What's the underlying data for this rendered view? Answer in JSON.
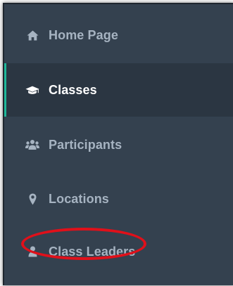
{
  "sidebar": {
    "items": [
      {
        "label": "Home Page",
        "icon": "home-icon",
        "active": false
      },
      {
        "label": "Classes",
        "icon": "graduation-cap-icon",
        "active": true
      },
      {
        "label": "Participants",
        "icon": "users-icon",
        "active": false
      },
      {
        "label": "Locations",
        "icon": "map-marker-icon",
        "active": false
      },
      {
        "label": "Class Leaders",
        "icon": "user-icon",
        "active": false
      }
    ]
  },
  "colors": {
    "sidebar_background": "#34414f",
    "active_background": "#2b3642",
    "active_accent": "#1fb89a",
    "inactive_text": "#a6b3c1",
    "active_text": "#ffffff",
    "annotation_circle": "#e0101a"
  }
}
